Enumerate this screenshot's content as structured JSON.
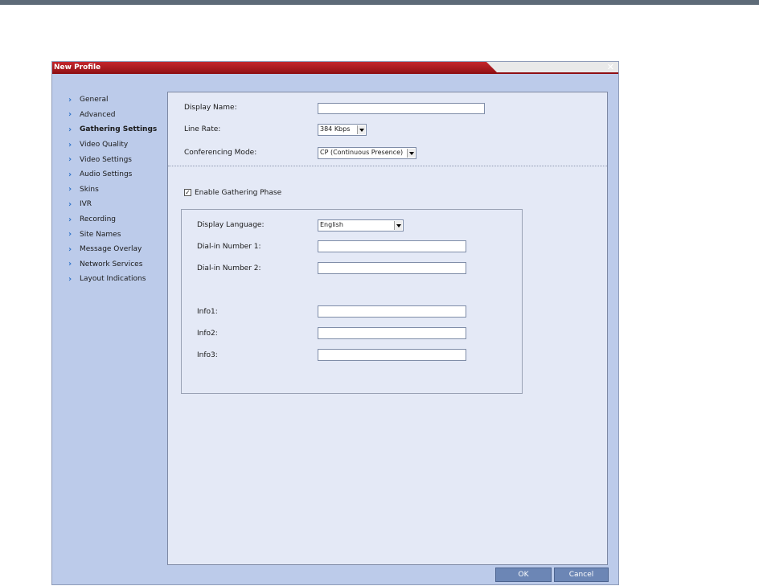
{
  "dialog": {
    "title": "New Profile",
    "close_glyph": "✕"
  },
  "nav": {
    "items": [
      {
        "label": "General",
        "active": false
      },
      {
        "label": "Advanced",
        "active": false
      },
      {
        "label": "Gathering Settings",
        "active": true
      },
      {
        "label": "Video Quality",
        "active": false
      },
      {
        "label": "Video Settings",
        "active": false
      },
      {
        "label": "Audio Settings",
        "active": false
      },
      {
        "label": "Skins",
        "active": false
      },
      {
        "label": "IVR",
        "active": false
      },
      {
        "label": "Recording",
        "active": false
      },
      {
        "label": "Site Names",
        "active": false
      },
      {
        "label": "Message Overlay",
        "active": false
      },
      {
        "label": "Network Services",
        "active": false
      },
      {
        "label": "Layout Indications",
        "active": false
      }
    ]
  },
  "form": {
    "display_name_label": "Display Name:",
    "display_name_value": "",
    "line_rate_label": "Line Rate:",
    "line_rate_value": "384 Kbps",
    "conf_mode_label": "Conferencing Mode:",
    "conf_mode_value": "CP (Continuous Presence)",
    "enable_gathering_label": "Enable Gathering Phase",
    "enable_gathering_checked": true,
    "display_language_label": "Display Language:",
    "display_language_value": "English",
    "dialin1_label": "Dial-in Number 1:",
    "dialin2_label": "Dial-in Number 2:",
    "info1_label": "Info1:",
    "info2_label": "Info2:",
    "info3_label": "Info3:"
  },
  "buttons": {
    "ok_label": "OK",
    "cancel_label": "Cancel"
  },
  "icons": {
    "nav_arrow": "chevron-right-icon",
    "check": "checkmark-icon"
  },
  "colors": {
    "title_bar": "#c4262c",
    "nav_bg": "#bccbea",
    "panel_bg": "#e4e9f6",
    "button": "#6c86b5"
  }
}
